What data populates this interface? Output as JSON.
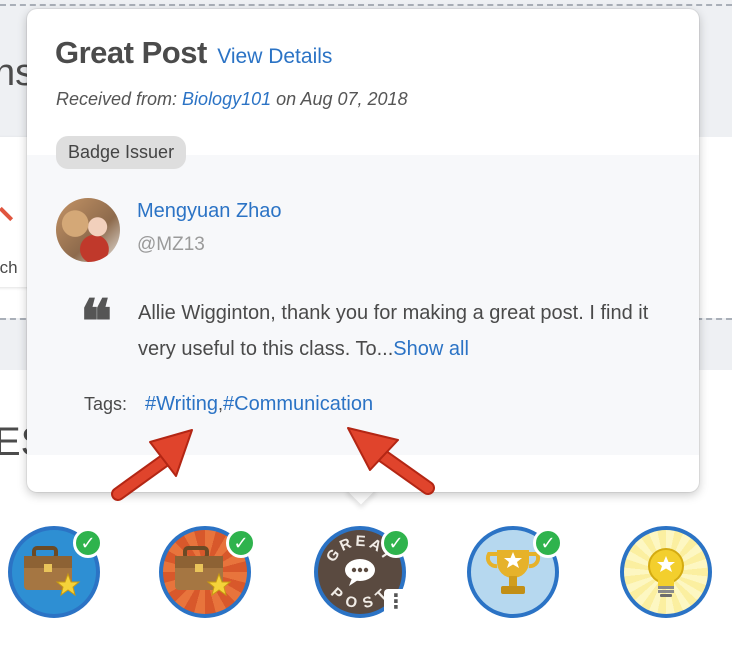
{
  "background": {
    "heading_fragment": "ns",
    "card_text_fragment": "rch",
    "section_fragment": "ES"
  },
  "popover": {
    "title": "Great Post",
    "view_details": "View Details",
    "received_prefix": "Received from: ",
    "issuer": "Biology101",
    "received_suffix": " on Aug 07, 2018",
    "issuer_badge": "Badge Issuer",
    "user_name": "Mengyuan Zhao",
    "user_handle": "@MZ13",
    "quote_mark": "❝",
    "message": "Allie Wigginton, thank you for making a great post. I find it very useful to this class. To...",
    "show_all": "Show all",
    "tags_label": "Tags:",
    "tags": [
      "#Writing",
      "#Communication"
    ],
    "tag_separator": ","
  },
  "badges": [
    {
      "icon": "briefcase-star-icon",
      "earned": true
    },
    {
      "icon": "briefcase-star-sunburst-icon",
      "earned": true
    },
    {
      "icon": "great-post-icon",
      "earned": true,
      "text_top": "GREAT",
      "text_bottom": "POST",
      "menu": "⋮"
    },
    {
      "icon": "trophy-star-icon",
      "earned": true
    },
    {
      "icon": "lightbulb-star-icon",
      "earned": false
    }
  ],
  "colors": {
    "link": "#2b73c5",
    "badge_ring": "#2b73c5",
    "check": "#2fb34d",
    "arrow": "#d93a25"
  }
}
